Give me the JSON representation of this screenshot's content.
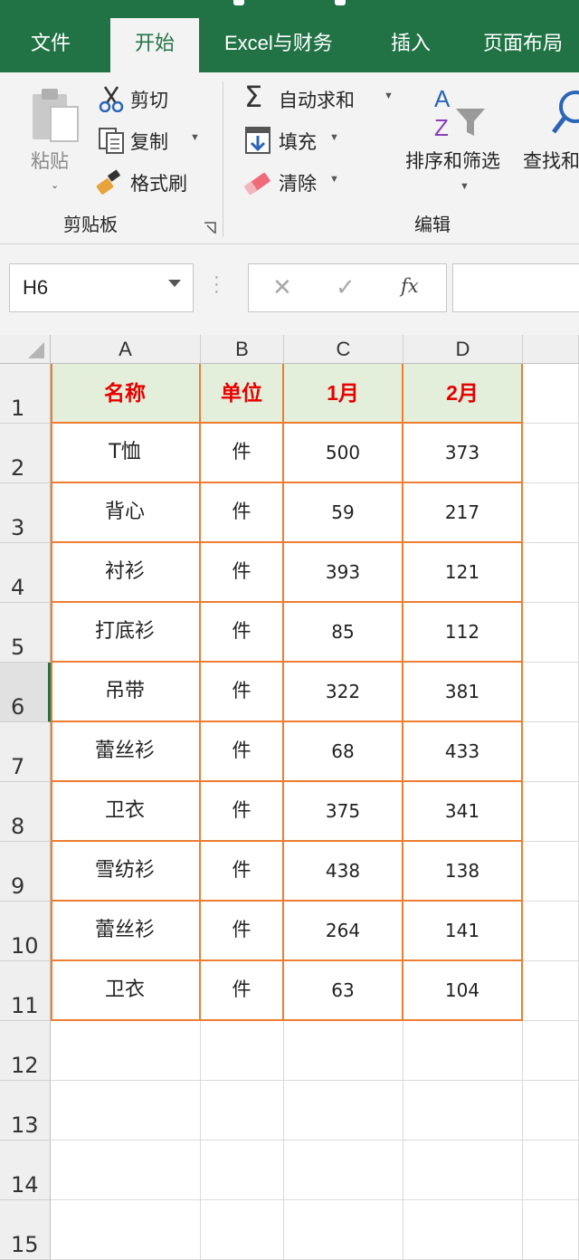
{
  "tabs": [
    "文件",
    "开始",
    "Excel与财务",
    "插入",
    "页面布局"
  ],
  "active_tab": "开始",
  "ribbon": {
    "paste": "粘贴",
    "cut": "剪切",
    "copy": "复制",
    "format_painter": "格式刷",
    "clipboard_group": "剪贴板",
    "autosum": "自动求和",
    "fill": "填充",
    "clear": "清除",
    "sort_filter": "排序和筛选",
    "find_select": "查找和",
    "editing_group": "编辑"
  },
  "formula_bar": {
    "name_box": "H6",
    "cancel_symbol": "✕",
    "enter_symbol": "✓",
    "fx_label": "fx",
    "formula_value": ""
  },
  "sheet": {
    "columns": [
      "A",
      "B",
      "C",
      "D"
    ],
    "rows": [
      "1",
      "2",
      "3",
      "4",
      "5",
      "6",
      "7",
      "8",
      "9",
      "10",
      "11",
      "12",
      "13",
      "14",
      "15"
    ],
    "selected_row": "6",
    "header": [
      "名称",
      "单位",
      "1月",
      "2月"
    ],
    "data": [
      [
        "T恤",
        "件",
        "500",
        "373"
      ],
      [
        "背心",
        "件",
        "59",
        "217"
      ],
      [
        "衬衫",
        "件",
        "393",
        "121"
      ],
      [
        "打底衫",
        "件",
        "85",
        "112"
      ],
      [
        "吊带",
        "件",
        "322",
        "381"
      ],
      [
        "蕾丝衫",
        "件",
        "68",
        "433"
      ],
      [
        "卫衣",
        "件",
        "375",
        "341"
      ],
      [
        "雪纺衫",
        "件",
        "438",
        "138"
      ],
      [
        "蕾丝衫",
        "件",
        "264",
        "141"
      ],
      [
        "卫衣",
        "件",
        "63",
        "104"
      ]
    ]
  },
  "colors": {
    "excel_green": "#217346",
    "table_border": "#ee7d31",
    "header_fill": "#e3efdb",
    "header_text": "#e60000"
  }
}
